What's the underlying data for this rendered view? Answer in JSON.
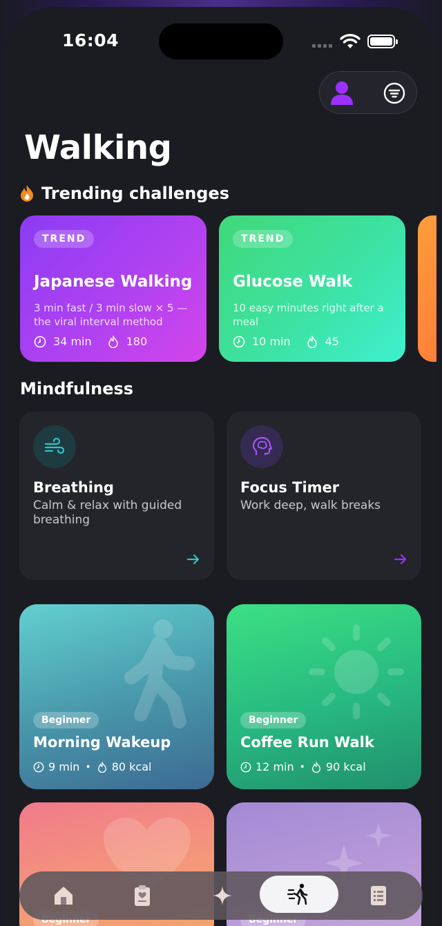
{
  "status_bar": {
    "time": "16:04"
  },
  "page": {
    "title": "Walking"
  },
  "trending": {
    "title": "Trending challenges",
    "cards": [
      {
        "badge": "TREND",
        "name": "Japanese Walking",
        "description": "3 min fast / 3 min slow × 5 — the viral interval method",
        "duration": "34 min",
        "calories": "180"
      },
      {
        "badge": "TREND",
        "name": "Glucose Walk",
        "description": "10 easy minutes right after a meal",
        "duration": "10 min",
        "calories": "45"
      }
    ]
  },
  "mindfulness": {
    "title": "Mindfulness",
    "cards": [
      {
        "name": "Breathing",
        "description": "Calm & relax with guided breathing"
      },
      {
        "name": "Focus Timer",
        "description": "Work deep, walk breaks"
      }
    ]
  },
  "workouts": [
    {
      "level": "Beginner",
      "name": "Morning Wakeup",
      "duration": "9 min",
      "calories": "80 kcal"
    },
    {
      "level": "Beginner",
      "name": "Coffee Run Walk",
      "duration": "12 min",
      "calories": "90 kcal"
    },
    {
      "level": "Beginner"
    },
    {
      "level": "Beginner"
    }
  ],
  "tabbar": {
    "items": [
      "home-icon",
      "clipboard-heart-icon",
      "sparkle-icon",
      "walking-icon",
      "list-icon"
    ],
    "active": "walking-icon"
  },
  "colors": {
    "accent": "#9b30ff",
    "teal": "#2ec4c4",
    "background": "#1b1c21"
  }
}
